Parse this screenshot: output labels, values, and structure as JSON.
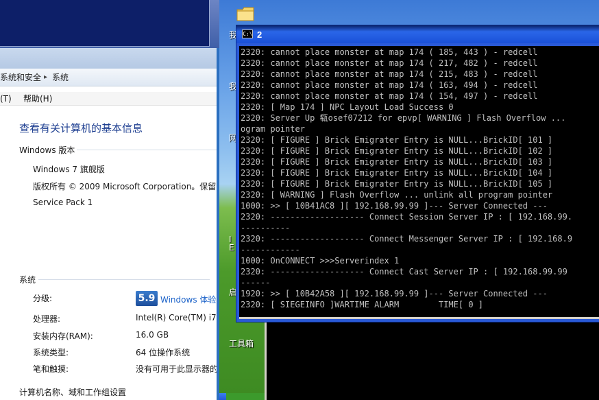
{
  "sys_window": {
    "breadcrumb": [
      "系统和安全",
      "系统"
    ],
    "menu": [
      "(T)",
      "帮助(H)"
    ],
    "title": "查看有关计算机的基本信息",
    "edition_heading": "Windows 版本",
    "edition": "Windows 7 旗舰版",
    "copyright": "版权所有 © 2009 Microsoft Corporation。保留",
    "service_pack": "Service Pack 1",
    "system_heading": "系统",
    "rating_label": "分级:",
    "rating_score": "5.9",
    "rating_link": "Windows 体验",
    "processor_label": "处理器:",
    "processor_value": "Intel(R) Core(TM) i7",
    "ram_label": "安装内存(RAM):",
    "ram_value": "16.0 GB",
    "type_label": "系统类型:",
    "type_value": "64 位操作系统",
    "pen_label": "笔和触摸:",
    "pen_value": "没有可用于此显示器的",
    "computer_heading": "计算机名称、域和工作组设置"
  },
  "console": {
    "title": "2",
    "icon_text": "C:\\",
    "lines": [
      "2320: cannot place monster at map 174 ( 185, 443 ) - redcell",
      "2320: cannot place monster at map 174 ( 217, 482 ) - redcell",
      "2320: cannot place monster at map 174 ( 215, 483 ) - redcell",
      "2320: cannot place monster at map 174 ( 163, 494 ) - redcell",
      "2320: cannot place monster at map 174 ( 154, 497 ) - redcell",
      "2320: [ Map 174 ] NPC Layout Load Success 0",
      "2320: Server Up 瓻osef07212 for epvp[ WARNING ] Flash Overflow ...",
      "ogram pointer",
      "2320: [ FIGURE ] Brick Emigrater Entry is NULL...BrickID[ 101 ]",
      "2320: [ FIGURE ] Brick Emigrater Entry is NULL...BrickID[ 102 ]",
      "2320: [ FIGURE ] Brick Emigrater Entry is NULL...BrickID[ 103 ]",
      "2320: [ FIGURE ] Brick Emigrater Entry is NULL...BrickID[ 104 ]",
      "2320: [ FIGURE ] Brick Emigrater Entry is NULL...BrickID[ 105 ]",
      "2320: [ WARNING ] Flash Overflow ... unlink all program pointer",
      "1000: >> [ 10B41AC8 ][ 192.168.99.99 ]--- Server Connected ---",
      "2320: ------------------- Connect Session Server IP : [ 192.168.99.",
      "----------",
      "2320: ------------------- Connect Messenger Server IP : [ 192.168.9",
      "------------",
      "1000: OnCONNECT >>>Serverindex 1",
      "2320: ------------------- Connect Cast Server IP : [ 192.168.99.99",
      "------",
      "1920: >> [ 10B42A58 ][ 192.168.99.99 ]--- Server Connected ---",
      "2320: [ SIEGEINFO ]WARTIME ALARM        TIME[ 0 ]"
    ]
  },
  "desktop": {
    "labels": [
      "我",
      "我",
      "网",
      "I",
      "E",
      "启"
    ],
    "tools_label": "工具箱"
  },
  "colors": {
    "console_bg": "#000000",
    "console_text": "#c0c0c0",
    "xp_titlebar": "#2a66e8",
    "win7_title": "#1e3f91"
  }
}
